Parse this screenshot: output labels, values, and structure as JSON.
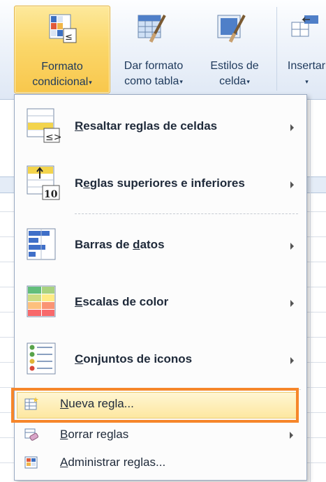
{
  "ribbon": {
    "formato_condicional": {
      "line1": "Formato",
      "line2": "condicional"
    },
    "dar_formato": {
      "line1": "Dar formato",
      "line2": "como tabla"
    },
    "estilos": {
      "line1": "Estilos de",
      "line2": "celda"
    },
    "insertar": {
      "line1": "Insertar"
    },
    "dropdown_caret": "▾"
  },
  "menu": {
    "items": [
      {
        "label_access": "R",
        "label_rest": "esaltar reglas de celdas",
        "icon": "highlight-cells-icon"
      },
      {
        "label_pre": "R",
        "label_access": "e",
        "label_rest": "glas superiores e inferiores",
        "icon": "top-bottom-rules-icon"
      },
      {
        "label_pre": "Barras de ",
        "label_access": "d",
        "label_rest": "atos",
        "icon": "data-bars-icon"
      },
      {
        "label_access": "E",
        "label_rest": "scalas de color",
        "icon": "color-scales-icon"
      },
      {
        "label_access": "C",
        "label_rest": "onjuntos de iconos",
        "icon": "icon-sets-icon"
      }
    ],
    "small_items": [
      {
        "label_access": "N",
        "label_rest": "ueva regla...",
        "icon": "new-rule-icon"
      },
      {
        "label_access": "B",
        "label_rest": "orrar reglas",
        "icon": "clear-rules-icon"
      },
      {
        "label_access": "A",
        "label_rest": "dministrar reglas...",
        "icon": "manage-rules-icon"
      }
    ]
  },
  "colors": {
    "highlight_border": "#f6862a",
    "ribbon_active": "#fbd76a",
    "text": "#1e395b"
  }
}
